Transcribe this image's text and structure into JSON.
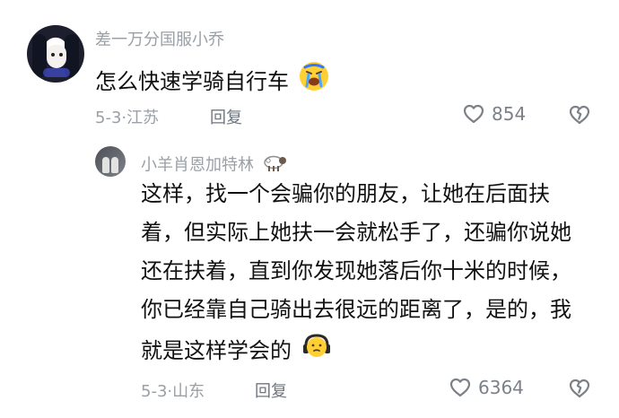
{
  "comments": [
    {
      "username": "差一万分国服小乔",
      "content": "怎么快速学骑自行车",
      "date_location": "5-3·江苏",
      "reply_label": "回复",
      "likes": "854",
      "emoji": "crying-face"
    },
    {
      "username": "小羊肖恩加特林",
      "content": "这样，找一个会骗你的朋友，让她在后面扶着，但实际上她扶一会就松手了，还骗你说她还在扶着，直到你发现她落后你十米的时候，你已经靠自己骑出去很远的距离了，是的，我就是这样学会的",
      "date_location": "5-3·山东",
      "reply_label": "回复",
      "likes": "6364",
      "emoji": "headphones-face",
      "badge_icon": "sheep-emoji"
    }
  ],
  "colors": {
    "username": "#9aa0a6",
    "text": "#111111",
    "meta": "#9aa0a6",
    "icon": "#7c8187"
  }
}
